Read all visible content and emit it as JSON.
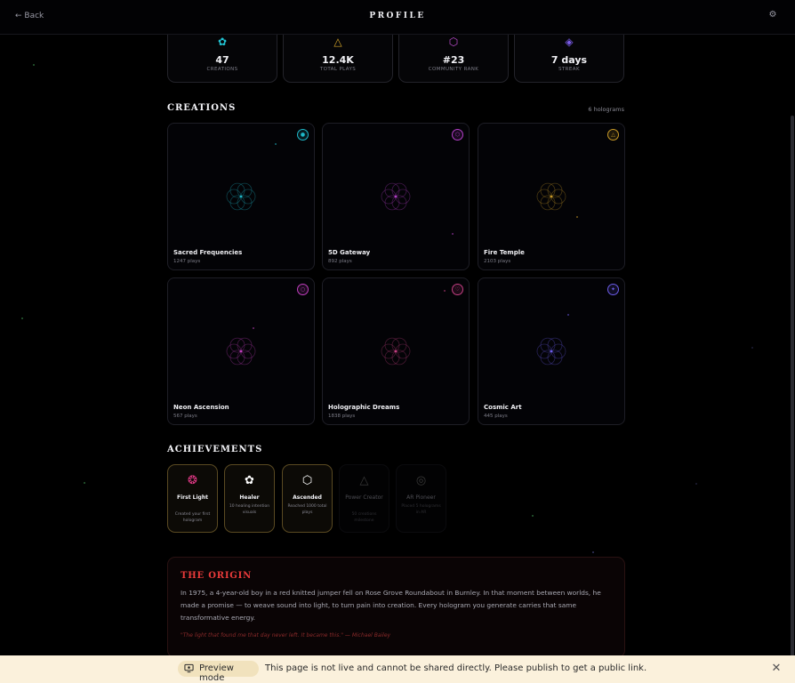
{
  "header": {
    "back_label": "← Back",
    "title": "PROFILE",
    "settings_icon": "gear-icon",
    "settings_glyph": "⚙"
  },
  "stats": [
    {
      "icon": "flower-icon",
      "glyph": "✿",
      "color": "#22c6d6",
      "value": "47",
      "label": "CREATIONS"
    },
    {
      "icon": "triangle-icon",
      "glyph": "△",
      "color": "#d4a52a",
      "value": "12.4K",
      "label": "TOTAL PLAYS"
    },
    {
      "icon": "hexagon-icon",
      "glyph": "⬡",
      "color": "#c44fd6",
      "value": "#23",
      "label": "COMMUNITY RANK"
    },
    {
      "icon": "diamond-icon",
      "glyph": "◈",
      "color": "#7a5ce8",
      "value": "7 days",
      "label": "STREAK"
    }
  ],
  "creations": {
    "title": "CREATIONS",
    "count_label": "6 holograms",
    "items": [
      {
        "name": "Sacred Frequencies",
        "plays": "1247 plays",
        "badge_icon": "circle-icon",
        "badge_glyph": "●",
        "color": "#1fb8c8"
      },
      {
        "name": "5D Gateway",
        "plays": "892 plays",
        "badge_icon": "hexagon-icon",
        "badge_glyph": "⬡",
        "color": "#b43fc8"
      },
      {
        "name": "Fire Temple",
        "plays": "2103 plays",
        "badge_icon": "triangle-icon",
        "badge_glyph": "△",
        "color": "#c89a28"
      },
      {
        "name": "Neon Ascension",
        "plays": "567 plays",
        "badge_icon": "ring-icon",
        "badge_glyph": "○",
        "color": "#c03fbe"
      },
      {
        "name": "Holographic Dreams",
        "plays": "1838 plays",
        "badge_icon": "heart-icon",
        "badge_glyph": "♡",
        "color": "#c43f82"
      },
      {
        "name": "Cosmic Art",
        "plays": "445 plays",
        "badge_icon": "sparkle-icon",
        "badge_glyph": "✦",
        "color": "#6b5ce8"
      }
    ]
  },
  "achievements": {
    "title": "ACHIEVEMENTS",
    "items": [
      {
        "name": "First Light",
        "desc": "Created your first hologram",
        "icon": "brain-icon",
        "glyph": "❂",
        "color": "#e83a8a",
        "unlocked": true
      },
      {
        "name": "Healer",
        "desc": "10 healing intention visuals",
        "icon": "flower-icon",
        "glyph": "✿",
        "color": "#ffffff",
        "unlocked": true
      },
      {
        "name": "Ascended",
        "desc": "Reached 1000 total plays",
        "icon": "hexagon-icon",
        "glyph": "⬡",
        "color": "#ffffff",
        "unlocked": true
      },
      {
        "name": "Power Creator",
        "desc": "50 creations milestone",
        "icon": "triangle-icon",
        "glyph": "△",
        "color": "#666666",
        "unlocked": false
      },
      {
        "name": "AR Pioneer",
        "desc": "Placed 5 holograms in AR",
        "icon": "target-icon",
        "glyph": "◎",
        "color": "#666666",
        "unlocked": false
      }
    ]
  },
  "origin": {
    "title": "THE ORIGIN",
    "body": "In 1975, a 4-year-old boy in a red knitted jumper fell on Rose Grove Roundabout in Burnley. In that moment between worlds, he made a promise — to weave sound into light, to turn pain into creation. Every hologram you generate carries that same transformative energy.",
    "quote": "\"The light that found me that day never left. It became this.\" — Michael Bailey"
  },
  "banner": {
    "pill_label": "Preview mode",
    "message": "This page is not live and cannot be shared directly. Please publish to get a public link.",
    "close_glyph": "✕"
  }
}
